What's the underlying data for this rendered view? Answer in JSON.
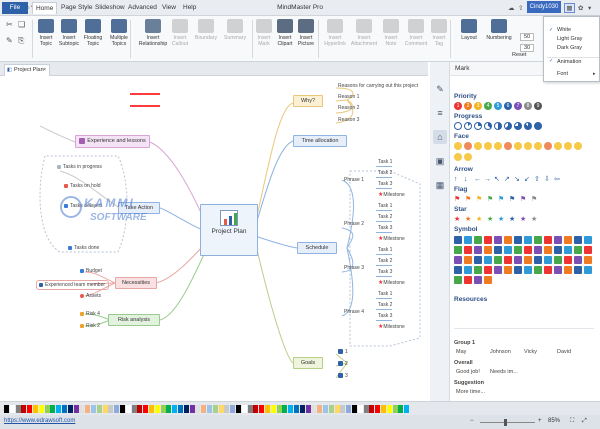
{
  "app": {
    "title": "MindMaster Pro",
    "user": "Cindy1030"
  },
  "menu": {
    "file": "File",
    "items": [
      "Home",
      "Page Style",
      "Slideshow",
      "Advanced",
      "View",
      "Help"
    ]
  },
  "ribbon": {
    "buttons": [
      {
        "id": "insert-topic",
        "label": "Insert\nTopic",
        "enabled": true,
        "color": "#4f6f98"
      },
      {
        "id": "insert-subtopic",
        "label": "Insert\nSubtopic",
        "enabled": true,
        "color": "#4f6f98"
      },
      {
        "id": "floating-topic",
        "label": "Floating\nTopic",
        "enabled": true,
        "color": "#4f6f98"
      },
      {
        "id": "multiple-topics",
        "label": "Multiple\nTopics",
        "enabled": true,
        "color": "#4f6f98"
      },
      {
        "id": "insert-relationship",
        "label": "Insert\nRelationship",
        "enabled": true,
        "color": "#6a7f99"
      },
      {
        "id": "insert-callout",
        "label": "Insert\nCallout",
        "enabled": false,
        "color": "#888"
      },
      {
        "id": "boundary",
        "label": "Boundary",
        "enabled": false,
        "color": "#888"
      },
      {
        "id": "summary",
        "label": "Summary",
        "enabled": false,
        "color": "#888"
      },
      {
        "id": "insert-mark",
        "label": "Insert\nMark",
        "enabled": false,
        "color": "#888"
      },
      {
        "id": "insert-clipart",
        "label": "Insert\nClipart",
        "enabled": true,
        "color": "#5b6c83"
      },
      {
        "id": "insert-picture",
        "label": "Insert\nPicture",
        "enabled": true,
        "color": "#5b6c83"
      },
      {
        "id": "insert-hyperlink",
        "label": "Insert\nHyperlink",
        "enabled": false,
        "color": "#888"
      },
      {
        "id": "insert-attachment",
        "label": "Insert\nAttachment",
        "enabled": false,
        "color": "#888"
      },
      {
        "id": "insert-note",
        "label": "Insert\nNote",
        "enabled": false,
        "color": "#888"
      },
      {
        "id": "insert-comment",
        "label": "Insert\nComment",
        "enabled": false,
        "color": "#888"
      },
      {
        "id": "insert-tag",
        "label": "Insert\nTag",
        "enabled": false,
        "color": "#888"
      },
      {
        "id": "layout",
        "label": "Layout",
        "enabled": true,
        "color": "#4f6f98"
      },
      {
        "id": "numbering",
        "label": "Numbering",
        "enabled": true,
        "color": "#4f6f98"
      }
    ],
    "spin1": "50",
    "spin2": "30",
    "reset": "Reset"
  },
  "theme_menu": {
    "items": [
      "White",
      "Light Gray",
      "Dark Gray",
      "Animation",
      "Font"
    ]
  },
  "doc_tab": "Project Plan",
  "mindmap": {
    "central": "Project Plan",
    "left_topics": [
      "Experience and lessons",
      "Take Action",
      "Necessities",
      "Risk analysis"
    ],
    "tasks": [
      "Tasks in progress",
      "Tasks on hold",
      "Tasks delayed",
      "Tasks done"
    ],
    "necessities": [
      "Budget",
      "Experienced team member",
      "Assets"
    ],
    "risks": [
      "Risk 4",
      "Risk 2"
    ],
    "right_topics": [
      "Why?",
      "Time allocation",
      "Schedule",
      "Goals"
    ],
    "why_items": [
      "Reasons for carrying out this project",
      "Reason 1",
      "Reason 2",
      "Reason 3"
    ],
    "phases": [
      "Phrase 1",
      "Phrase 2",
      "Phrase 3",
      "Phrase 4"
    ],
    "task_items": [
      "Task 1",
      "Task 2",
      "Task 3"
    ],
    "milestone": "Milestone",
    "goal_items": [
      "1",
      "2",
      "3"
    ]
  },
  "panel": {
    "title": "Mark",
    "sections": [
      "Priority",
      "Progress",
      "Face",
      "Arrow",
      "Flag",
      "Star",
      "Symbol",
      "Resources"
    ],
    "priority_numbers": [
      "1",
      "2",
      "3",
      "4",
      "5",
      "6",
      "7",
      "8",
      "9"
    ],
    "resources": {
      "group": "Group 1",
      "names": [
        "May",
        "Johnson",
        "Vicky",
        "David"
      ]
    },
    "overall": {
      "label": "Overall",
      "items": [
        "Good job!",
        "Needs im..."
      ]
    },
    "suggestion": {
      "label": "Suggestion",
      "more": "More time..."
    }
  },
  "status": {
    "url": "https://www.edrawsoft.com",
    "zoom": "85%"
  },
  "colors": {
    "accent": "#2e62a8"
  }
}
